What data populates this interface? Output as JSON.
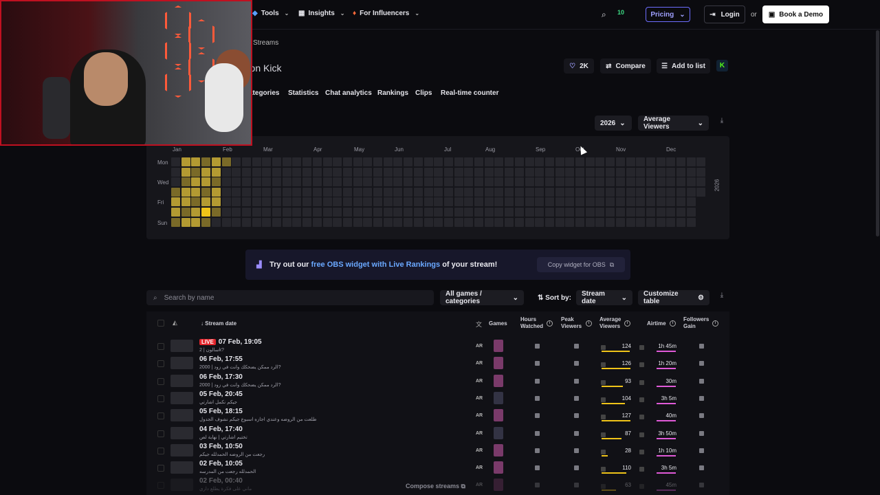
{
  "nav": {
    "tools": "Tools",
    "insights": "Insights",
    "for_influencers": "For Influencers",
    "pricing": "Pricing",
    "login": "Login",
    "or": "or",
    "book_demo": "Book a Demo",
    "badge": "10"
  },
  "header": {
    "breadcrumb": "Streams",
    "title": "ms on Kick",
    "likes": "2K",
    "compare": "Compare",
    "add_to_list": "Add to list",
    "kick_letter": "K"
  },
  "subtabs": [
    "ategories",
    "Statistics",
    "Chat analytics",
    "Rankings",
    "Clips",
    "Real-time counter"
  ],
  "heatmap": {
    "year_select": "2026",
    "metric_select": "Average Viewers",
    "months": [
      "Jan",
      "Feb",
      "Mar",
      "Apr",
      "May",
      "Jun",
      "Jul",
      "Aug",
      "Sep",
      "Oct",
      "Nov",
      "Dec"
    ],
    "days": [
      "Mon",
      "Wed",
      "Fri",
      "Sun"
    ],
    "year_side": "2026",
    "colors": {
      "empty": "#26262c",
      "low": "#7a6a28",
      "mid": "#b39a32",
      "high": "#f0c419"
    }
  },
  "banner": {
    "prefix": "Try out our ",
    "highlight": "free OBS widget with Live Rankings",
    "suffix": " of your stream!",
    "copy": "Copy widget for OBS"
  },
  "toolbar": {
    "search_placeholder": "Search by name",
    "games_filter": "All games / categories",
    "sort_by": "Sort by:",
    "sort_value": "Stream date",
    "customize": "Customize table"
  },
  "table": {
    "headers": {
      "stream_date": "Stream date",
      "games": "Games",
      "hours_watched": "Hours Watched",
      "peak_viewers": "Peak Viewers",
      "average_viewers": "Average Viewers",
      "airtime": "Airtime",
      "followers_gain": "Followers Gain"
    },
    "live_label": "LIVE",
    "rows": [
      {
        "date": "07 Feb, 19:05",
        "title": "سالون | 2k?",
        "lang": "AR",
        "avg": "124",
        "airtime": "1h 45m",
        "live": true
      },
      {
        "date": "06 Feb, 17:55",
        "title": "الرد ممكن يضحكك وانت في زود | 2000?",
        "lang": "AR",
        "avg": "126",
        "airtime": "1h 20m"
      },
      {
        "date": "06 Feb, 17:30",
        "title": "الرد ممكن يضحكك وانت في زود | 2000?",
        "lang": "AR",
        "avg": "93",
        "airtime": "30m"
      },
      {
        "date": "05 Feb, 20:45",
        "title": "جيكم نكمل اشارتي",
        "lang": "AR",
        "avg": "104",
        "airtime": "3h 5m"
      },
      {
        "date": "05 Feb, 18:15",
        "title": "طلعت من الروضه وعندي اجازه اسبوع جيكم نشوف الجدول",
        "lang": "AR",
        "avg": "127",
        "airtime": "40m"
      },
      {
        "date": "04 Feb, 17:40",
        "title": "تختيم اشارتي | نهاية لص",
        "lang": "AR",
        "avg": "87",
        "airtime": "3h 50m"
      },
      {
        "date": "03 Feb, 10:50",
        "title": "رجعت من الروضه الحمدلله جيكم",
        "lang": "AR",
        "avg": "28",
        "airtime": "1h 10m"
      },
      {
        "date": "02 Feb, 10:05",
        "title": "الحمدلله رجعت من المدرسه",
        "lang": "AR",
        "avg": "110",
        "airtime": "3h 5m"
      },
      {
        "date": "02 Feb, 00:40",
        "title": "ماني على فكرة يطلع داري",
        "lang": "AR",
        "avg": "63",
        "airtime": "45m"
      }
    ],
    "compose": "Compose streams"
  }
}
